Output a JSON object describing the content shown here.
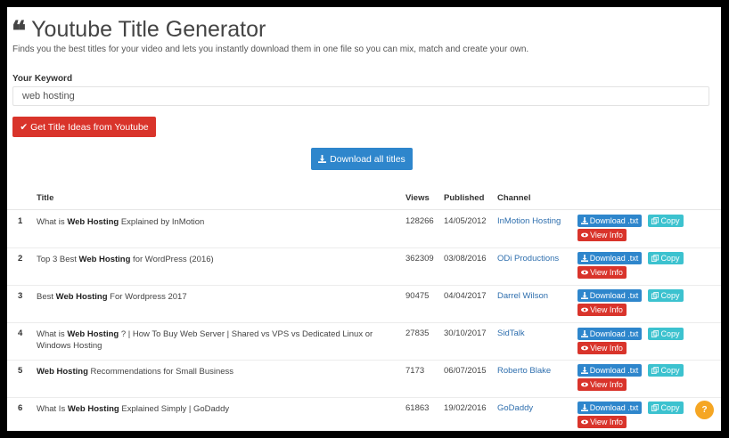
{
  "header": {
    "title": "Youtube Title Generator",
    "subtitle": "Finds you the best titles for your video and lets you instantly download them in one file so you can mix, match and create your own."
  },
  "keyword": {
    "label": "Your Keyword",
    "value": "web hosting"
  },
  "buttons": {
    "ideas": "Get Title Ideas from Youtube",
    "download_all": "Download all titles"
  },
  "columns": {
    "title": "Title",
    "views": "Views",
    "published": "Published",
    "channel": "Channel"
  },
  "row_actions": {
    "download": "Download .txt",
    "copy": "Copy",
    "view": "View Info"
  },
  "rows": [
    {
      "num": "1",
      "pre": "What is ",
      "bold": "Web Hosting",
      "post": " Explained by InMotion",
      "views": "128266",
      "published": "14/05/2012",
      "channel": "InMotion Hosting"
    },
    {
      "num": "2",
      "pre": "Top 3 Best ",
      "bold": "Web Hosting",
      "post": " for WordPress (2016)",
      "views": "362309",
      "published": "03/08/2016",
      "channel": "ODi Productions"
    },
    {
      "num": "3",
      "pre": "Best ",
      "bold": "Web Hosting",
      "post": " For Wordpress 2017",
      "views": "90475",
      "published": "04/04/2017",
      "channel": "Darrel Wilson"
    },
    {
      "num": "4",
      "pre": "What is ",
      "bold": "Web Hosting",
      "post": " ? | How To Buy Web Server | Shared vs VPS vs Dedicated Linux or Windows Hosting",
      "views": "27835",
      "published": "30/10/2017",
      "channel": "SidTalk"
    },
    {
      "num": "5",
      "pre": "",
      "bold": "Web Hosting",
      "post": " Recommendations for Small Business",
      "views": "7173",
      "published": "06/07/2015",
      "channel": "Roberto Blake"
    },
    {
      "num": "6",
      "pre": "What Is ",
      "bold": "Web Hosting",
      "post": " Explained Simply | GoDaddy",
      "views": "61863",
      "published": "19/02/2016",
      "channel": "GoDaddy"
    }
  ],
  "help": {
    "label": "?"
  },
  "icons": {
    "quote": "quote-icon",
    "check": "check-icon",
    "download": "download-icon",
    "copy": "copy-icon",
    "eye": "eye-icon"
  },
  "colors": {
    "red": "#d9342b",
    "blue": "#2e86cc",
    "cyan": "#3cc2cf",
    "link": "#2f6fae",
    "orange": "#f5a623"
  }
}
